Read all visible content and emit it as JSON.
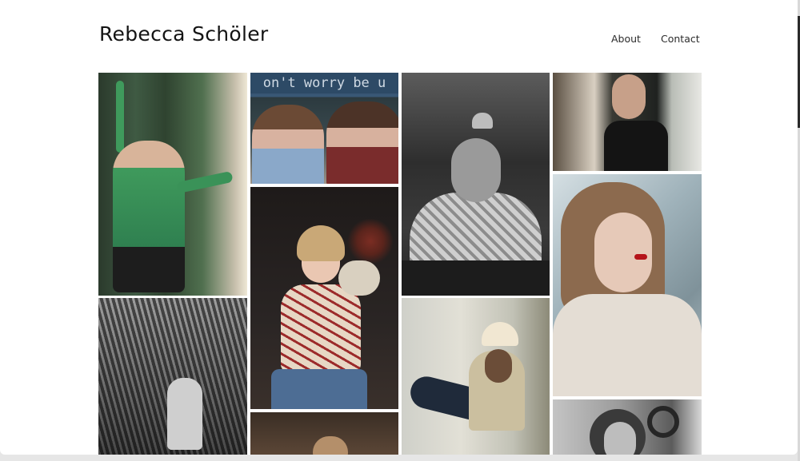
{
  "site": {
    "title": "Rebecca Schöler"
  },
  "nav": {
    "items": [
      {
        "label": "About"
      },
      {
        "label": "Contact"
      }
    ]
  },
  "gallery": {
    "photos": [
      {
        "name": "woman-green-curtain-photo",
        "caption": ""
      },
      {
        "name": "couple-street-photo",
        "sign_text": "on't worry be u"
      },
      {
        "name": "man-at-table-photo",
        "caption": ""
      },
      {
        "name": "boy-by-window-photo",
        "caption": ""
      },
      {
        "name": "woman-red-lips-photo",
        "caption": ""
      },
      {
        "name": "greenhouse-photo",
        "caption": ""
      },
      {
        "name": "woman-with-vase-photo",
        "caption": ""
      },
      {
        "name": "man-on-chair-photo",
        "caption": ""
      },
      {
        "name": "portrait-partial-photo",
        "caption": ""
      },
      {
        "name": "violinist-photo",
        "caption": ""
      }
    ]
  },
  "colors": {
    "background": "#ffffff",
    "text": "#141414",
    "nav_text": "#2b2b2b"
  }
}
